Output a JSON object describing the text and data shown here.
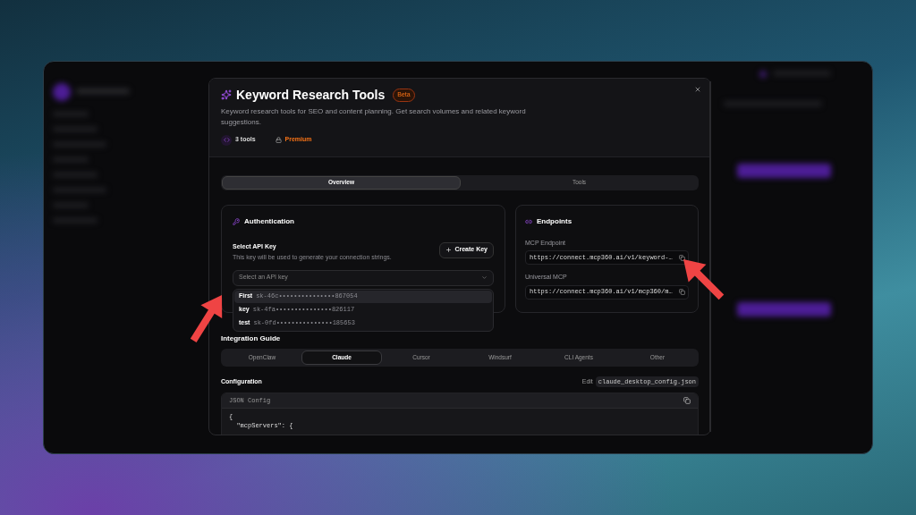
{
  "modal": {
    "title": "Keyword Research Tools",
    "badge": "Beta",
    "description": "Keyword research tools for SEO and content planning. Get search volumes and related keyword suggestions.",
    "tools_count": "3 tools",
    "tier": "Premium"
  },
  "tabs": [
    {
      "label": "Overview",
      "selected": true
    },
    {
      "label": "Tools",
      "selected": false
    }
  ],
  "authentication": {
    "title": "Authentication",
    "field_label": "Select API Key",
    "hint": "This key will be used to generate your connection strings.",
    "create_button": "Create Key",
    "select_placeholder": "Select an API key",
    "options": [
      {
        "name": "First",
        "key": "sk-46c•••••••••••••••867054",
        "highlighted": true
      },
      {
        "name": "key",
        "key": "sk-4fa•••••••••••••••826117",
        "highlighted": false
      },
      {
        "name": "test",
        "key": "sk-0fd•••••••••••••••185653",
        "highlighted": false
      }
    ]
  },
  "endpoints": {
    "title": "Endpoints",
    "items": [
      {
        "label": "MCP Endpoint",
        "url": "https://connect.mcp360.ai/v1/keyword-…"
      },
      {
        "label": "Universal MCP",
        "url": "https://connect.mcp360.ai/v1/mcp360/m…"
      }
    ]
  },
  "integration_guide": {
    "title": "Integration Guide",
    "tabs": [
      {
        "label": "OpenClaw",
        "selected": false
      },
      {
        "label": "Claude",
        "selected": true
      },
      {
        "label": "Cursor",
        "selected": false
      },
      {
        "label": "Windsurf",
        "selected": false
      },
      {
        "label": "CLI Agents",
        "selected": false
      },
      {
        "label": "Other",
        "selected": false
      }
    ]
  },
  "configuration": {
    "title": "Configuration",
    "edit_label": "Edit",
    "file": "claude_desktop_config.json",
    "block_title": "JSON Config",
    "code_lines": [
      "{",
      "  \"mcpServers\": {"
    ]
  }
}
